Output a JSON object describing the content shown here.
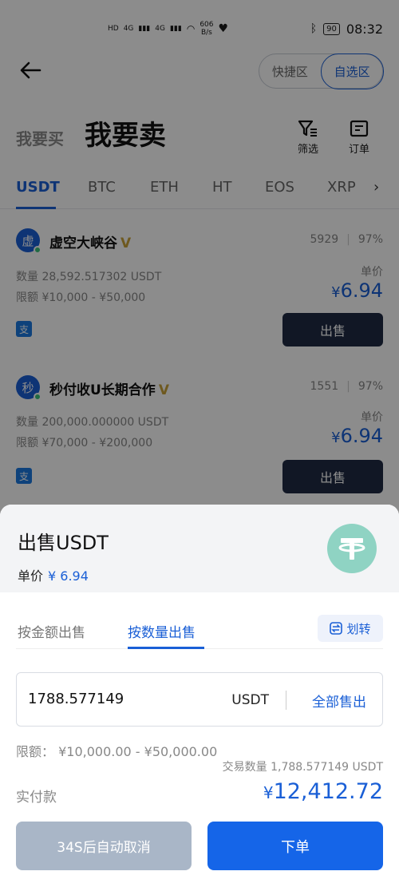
{
  "status_bar": {
    "network_left": "HD",
    "network_type_1": "4G",
    "network_type_2": "4G",
    "speed": "606",
    "speed_unit": "B/s",
    "battery": "90",
    "time": "08:32"
  },
  "nav": {
    "segments": [
      "快捷区",
      "自选区"
    ],
    "active_segment": "自选区"
  },
  "trade_mode": {
    "buy_label": "我要买",
    "sell_label": "我要卖"
  },
  "tools": {
    "filter_label": "筛选",
    "orders_label": "订单"
  },
  "coin_tabs": [
    "USDT",
    "BTC",
    "ETH",
    "HT",
    "EOS",
    "XRP"
  ],
  "listings": [
    {
      "avatar_char": "虚",
      "name": "虚空大峡谷",
      "badge": "V",
      "trades": "5929",
      "rate": "97%",
      "quantity": "数量 28,592.517302 USDT",
      "limit": "限额 ¥10,000 - ¥50,000",
      "unit_label": "单价",
      "price_symbol": "¥",
      "price": "6.94",
      "pay_method": "支",
      "action": "出售"
    },
    {
      "avatar_char": "秒",
      "name": "秒付收U长期合作",
      "badge": "V",
      "trades": "1551",
      "rate": "97%",
      "quantity": "数量 200,000.000000 USDT",
      "limit": "限额 ¥70,000 - ¥200,000",
      "unit_label": "单价",
      "price_symbol": "¥",
      "price": "6.94",
      "pay_method": "支",
      "action": "出售"
    }
  ],
  "sheet": {
    "title": "出售USDT",
    "unit_price_label": "单价",
    "unit_price_value": "¥ 6.94",
    "mode_tabs": [
      "按金额出售",
      "按数量出售"
    ],
    "active_mode": "按数量出售",
    "transfer_label": "划转",
    "quantity_value": "1788.577149",
    "quantity_unit": "USDT",
    "sell_all_label": "全部售出",
    "limit_text": "限额： ¥10,000.00 - ¥50,000.00",
    "trade_quantity": "交易数量 1,788.577149 USDT",
    "pay_label": "实付款",
    "pay_symbol": "¥",
    "pay_total": "12,412.72",
    "cancel_label": "34S后自动取消",
    "order_label": "下单"
  },
  "colors": {
    "accent": "#1a5fd6",
    "primary_button": "#1565e8",
    "disabled_button": "#a9b6c7",
    "dark_button": "#1f2a44",
    "tether": "#8fd3c3"
  }
}
